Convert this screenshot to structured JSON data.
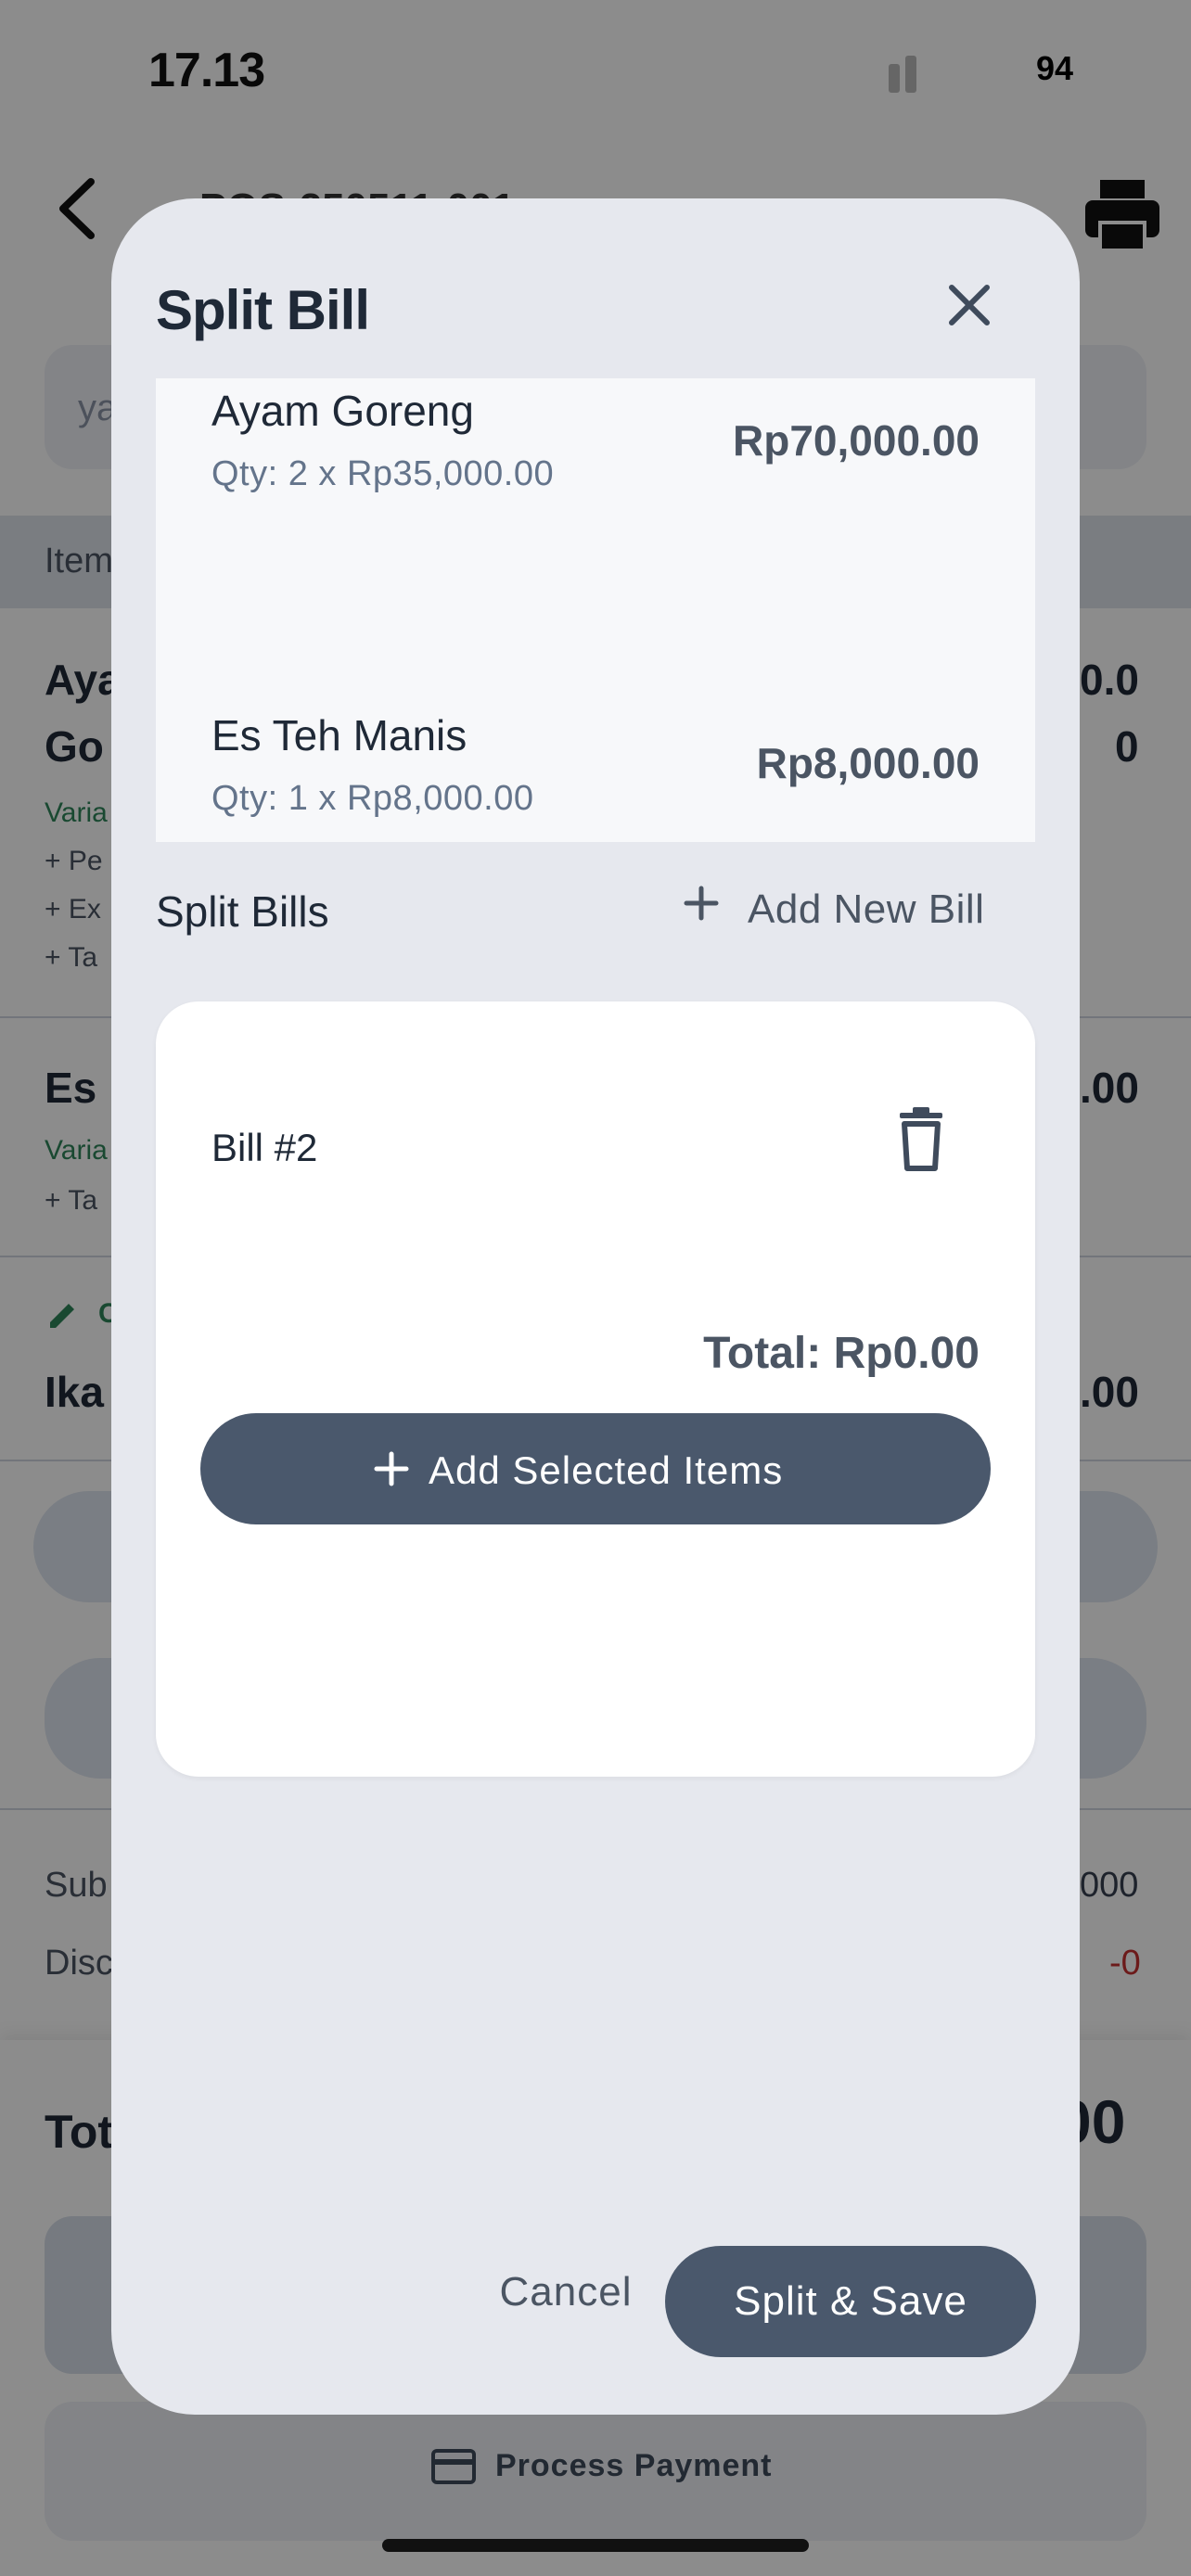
{
  "status_bar": {
    "time": "17.13",
    "battery": "94"
  },
  "background": {
    "order_title": "POS-250511-001",
    "notes_placeholder": "ya",
    "items_header": "Item",
    "rows": [
      {
        "name_line1": "Aya",
        "name_line2": "Go",
        "variant": "Varia",
        "addons": [
          "+ Pe",
          "+ Ex",
          "+ Ta"
        ],
        "price_line1": "0.0",
        "price_line2": "0"
      },
      {
        "name_line1": "Es",
        "variant": "Varia",
        "addons": [
          "+ Ta"
        ],
        "price_line1": ".00"
      },
      {
        "note_prefix": "C",
        "name_line1": "Ika",
        "price_line1": ".00"
      }
    ],
    "subtotal_label": "Sub",
    "subtotal_value": "000",
    "discount_label": "Disc",
    "discount_value": "-0",
    "total_label": "Tot",
    "total_value": "00",
    "process_payment": "Process Payment"
  },
  "modal": {
    "title": "Split Bill",
    "items": [
      {
        "name": "Ayam Goreng",
        "qty": "Qty: 2 x Rp35,000.00",
        "price": "Rp70,000.00"
      },
      {
        "name": "Es Teh Manis",
        "qty": "Qty: 1 x Rp8,000.00",
        "price": "Rp8,000.00"
      }
    ],
    "split_bills_label": "Split Bills",
    "add_new_bill": "Add New Bill",
    "bills": [
      {
        "name": "Bill #2",
        "total": "Total: Rp0.00",
        "add_items_label": "Add Selected Items"
      }
    ],
    "cancel_label": "Cancel",
    "save_label": "Split & Save"
  },
  "colors": {
    "primary_button": "#4a586c",
    "modal_bg": "#e6e8ee",
    "variant_green": "#2f855a",
    "discount_red": "#c53030"
  }
}
